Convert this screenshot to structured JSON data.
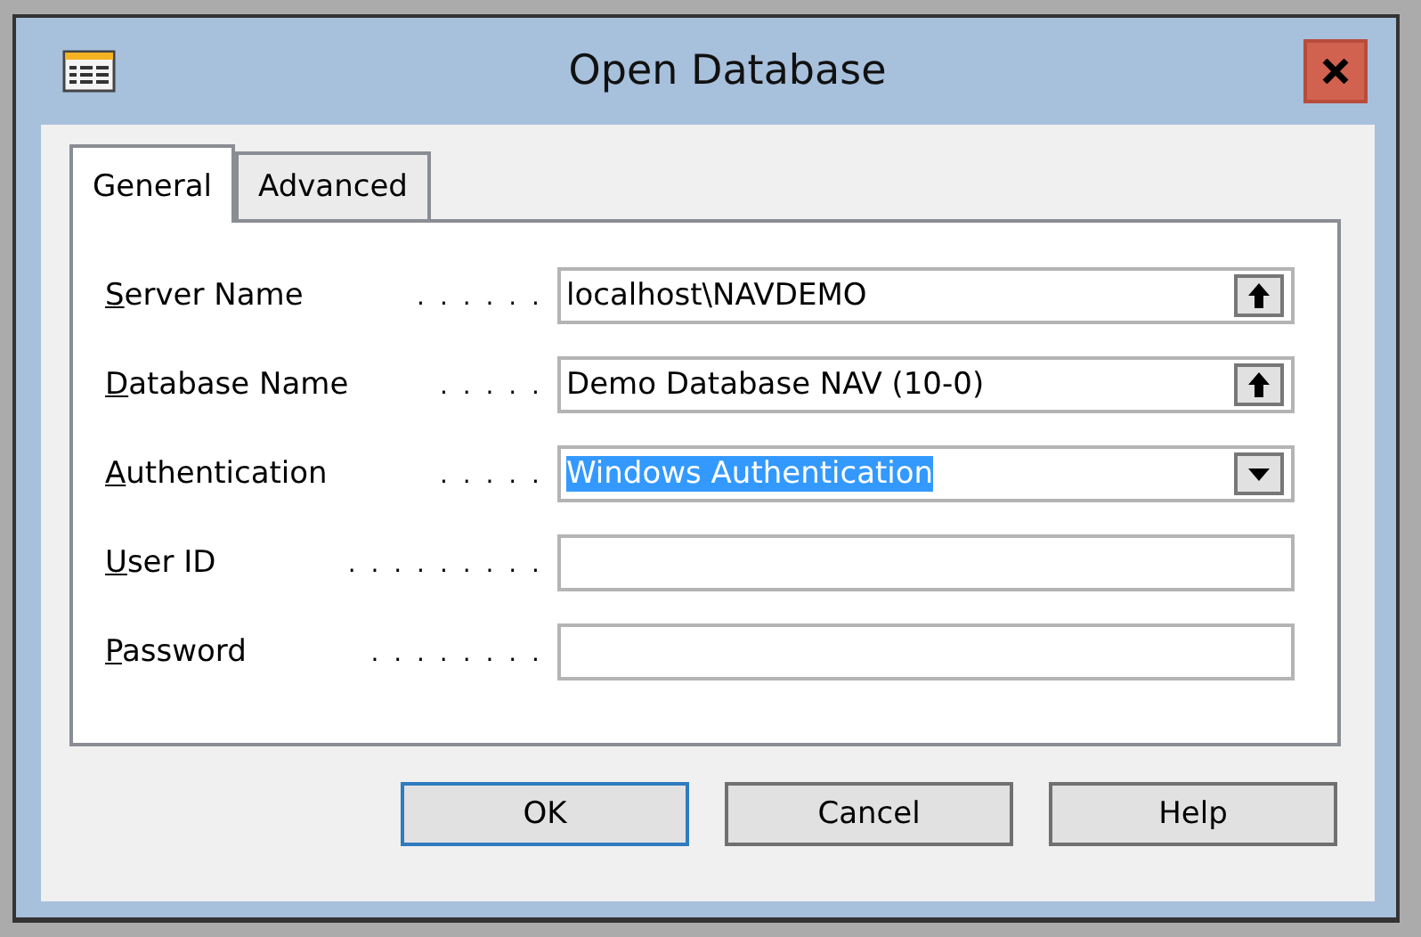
{
  "window": {
    "title": "Open Database"
  },
  "tabs": [
    {
      "label": "General",
      "selected": true
    },
    {
      "label": "Advanced",
      "selected": false
    }
  ],
  "fields": [
    {
      "label": "Server Name",
      "dots": ". . . . . .",
      "kind": "lookup",
      "value": "localhost\\NAVDEMO",
      "highlighted": false
    },
    {
      "label": "Database Name",
      "dots": ". . . . .",
      "kind": "lookup",
      "value": "Demo Database NAV (10-0)",
      "highlighted": false
    },
    {
      "label": "Authentication",
      "dots": ". . . . .",
      "kind": "dropdown",
      "value": "Windows Authentication",
      "highlighted": true
    },
    {
      "label": "User ID",
      "dots": ". . . . . . . . .",
      "kind": "text"
    },
    {
      "label": "Password",
      "dots": ". . . . . . . .",
      "kind": "text"
    }
  ],
  "buttons": [
    {
      "label": "OK",
      "default": true
    },
    {
      "label": "Cancel",
      "default": false
    },
    {
      "label": "Help",
      "default": false
    }
  ]
}
